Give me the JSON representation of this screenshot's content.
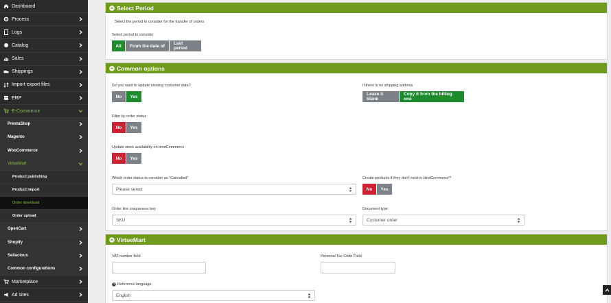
{
  "sidebar": {
    "items": [
      {
        "label": "Dashboard",
        "icon": "home-icon"
      },
      {
        "label": "Process",
        "icon": "gear-icon"
      },
      {
        "label": "Logs",
        "icon": "file-icon"
      },
      {
        "label": "Catalog",
        "icon": "catalog-icon"
      },
      {
        "label": "Sales",
        "icon": "bar-chart-icon"
      },
      {
        "label": "Shippings",
        "icon": "truck-icon"
      },
      {
        "label": "Import export files",
        "icon": "sort-icon"
      },
      {
        "label": "ERP",
        "icon": "database-icon"
      },
      {
        "label": "E-Commerce",
        "icon": "cart-icon"
      },
      {
        "label": "PrestaShop"
      },
      {
        "label": "Magento"
      },
      {
        "label": "WooCommerce"
      },
      {
        "label": "VirtueMart"
      },
      {
        "label": "Product publishing"
      },
      {
        "label": "Product import"
      },
      {
        "label": "Order download"
      },
      {
        "label": "Order upload"
      },
      {
        "label": "OpenCart"
      },
      {
        "label": "Shopify"
      },
      {
        "label": "Sellacious"
      },
      {
        "label": "Common configurations"
      },
      {
        "label": "Marketplace",
        "icon": "cart-icon"
      },
      {
        "label": "Ad sites",
        "icon": "megaphone-icon"
      }
    ]
  },
  "select_period": {
    "title": "Select Period",
    "description": "Select the period to consider for the transfer of orders",
    "label": "Select period to consider",
    "options": [
      "All",
      "From the date of",
      "Last period"
    ]
  },
  "common_options": {
    "title": "Common options",
    "update_customer_label": "Do you want to update existing customer data?",
    "no_label": "No",
    "yes_label": "Yes",
    "shipping_label": "If there is no shipping address",
    "leave_blank_label": "Leave it blank",
    "copy_billing_label": "Copy it from the billing one",
    "filter_status_label": "Filter by order status",
    "update_stock_label": "Update stock availability on bindCommerce",
    "cancelled_status_label": "Which order status to consider as \"Cancelled\"",
    "cancelled_status_value": "Please select",
    "create_products_label": "Create products if they don't exist in bindCommerce?",
    "uniqueness_key_label": "Order line uniqueness key",
    "uniqueness_key_value": "SKU",
    "document_type_label": "Document type",
    "document_type_value": "Customer order"
  },
  "virtuemart": {
    "title": "VirtueMart",
    "vat_label": "VAT number field",
    "tax_code_label": "Personal Tax Code Field",
    "language_label": "Reference language",
    "language_value": "English"
  },
  "colors": {
    "accent": "#6f9a1c",
    "sidebar_bg": "#2b2b2b",
    "active_green": "#1f8a2e",
    "danger_red": "#cc2233",
    "neutral_grey": "#7c8288",
    "highlight": "#8bc34a"
  }
}
